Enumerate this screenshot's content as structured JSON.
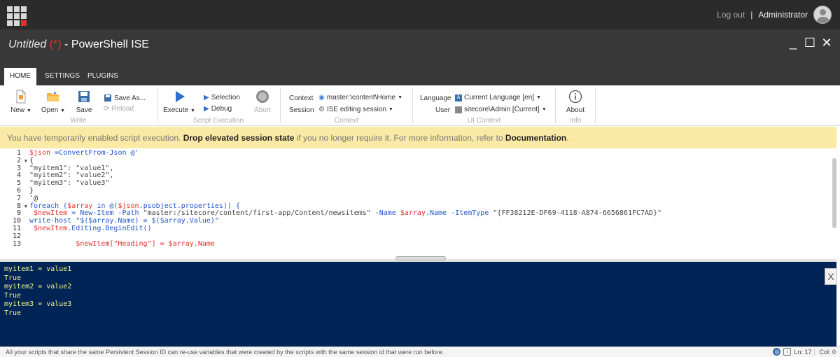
{
  "topbar": {
    "logout": "Log out",
    "separator": "|",
    "user": "Administrator"
  },
  "title": {
    "untitled": "Untitled",
    "modified": "(*)",
    "app": " - PowerShell ISE"
  },
  "window_controls": {
    "minimize": "_",
    "maximize": "☐",
    "close": "✕"
  },
  "tabs": [
    {
      "label": "HOME",
      "active": true
    },
    {
      "label": "SETTINGS"
    },
    {
      "label": "PLUGINS"
    }
  ],
  "ribbon": {
    "new": "New",
    "open": "Open",
    "save": "Save",
    "save_as": "Save As...",
    "reload": "Reload",
    "write_group": "Write",
    "execute": "Execute",
    "selection": "Selection",
    "debug": "Debug",
    "abort": "Abort",
    "script_group": "Script Execution",
    "context_label": "Context",
    "context_value": "master:\\content\\Home",
    "session_label": "Session",
    "session_value": "ISE editing session",
    "context_group": "Context",
    "language_label": "Language",
    "language_value": "Current Language [en]",
    "user_label": "User",
    "user_value": "sitecore\\Admin [Current]",
    "ui_group": "UI Context",
    "about": "About",
    "info_group": "Info"
  },
  "banner": {
    "prefix": "You have temporarily enabled script execution. ",
    "link": "Drop elevated session state",
    "middle": " if you no longer require it. For more information, refer to ",
    "doc": "Documentation",
    "suffix": "."
  },
  "editor": {
    "line_numbers": [
      "1",
      "2",
      "3",
      "4",
      "5",
      "6",
      "7",
      "8",
      "9",
      "10",
      "11",
      "12",
      "13"
    ],
    "lines": {
      "l1a": "$json",
      "l1b": " =ConvertFrom-Json @'",
      "l2": "{",
      "l3": "\"myitem1\": \"value1\",",
      "l4": "\"myitem2\": \"value2\",",
      "l5": "\"myitem3\": \"value3\"",
      "l6": "}",
      "l7": "'@",
      "l8a": "foreach (",
      "l8b": "$array",
      "l8c": " in @(",
      "l8d": "$json",
      "l8e": ".psobject.properties)) {",
      "l9a": " $newItem",
      "l9b": " = New-Item -Path ",
      "l9c": "\"master:/sitecore/content/first-app/Content/newsitems\"",
      "l9d": " -Name ",
      "l9e": "$array",
      "l9f": ".Name -ItemType ",
      "l9g": "\"{FF38212E-DF69-4118-A874-6656861FC7AD}\"",
      "l10": "write-host \"$($array.Name) = $($array.Value)\"",
      "l11a": " $newItem",
      "l11b": ".Editing.BeginEdit()",
      "l13": "           $newItem[\"Heading\"] = $array.Name"
    }
  },
  "console": {
    "lines": [
      "myitem1 = value1",
      "True",
      "myitem2 = value2",
      "True",
      "myitem3 = value3",
      "True"
    ],
    "close": "X"
  },
  "status": {
    "message": "All your scripts that share the same Persistent Session ID can re-use variables that were created by the scripts with the same session id that were run before.",
    "line": "Ln: 17",
    "col": "Col: 0"
  },
  "colors": {
    "accent_red": "#e3312b",
    "console_bg": "#012456",
    "banner_bg": "#fbe9a6"
  }
}
